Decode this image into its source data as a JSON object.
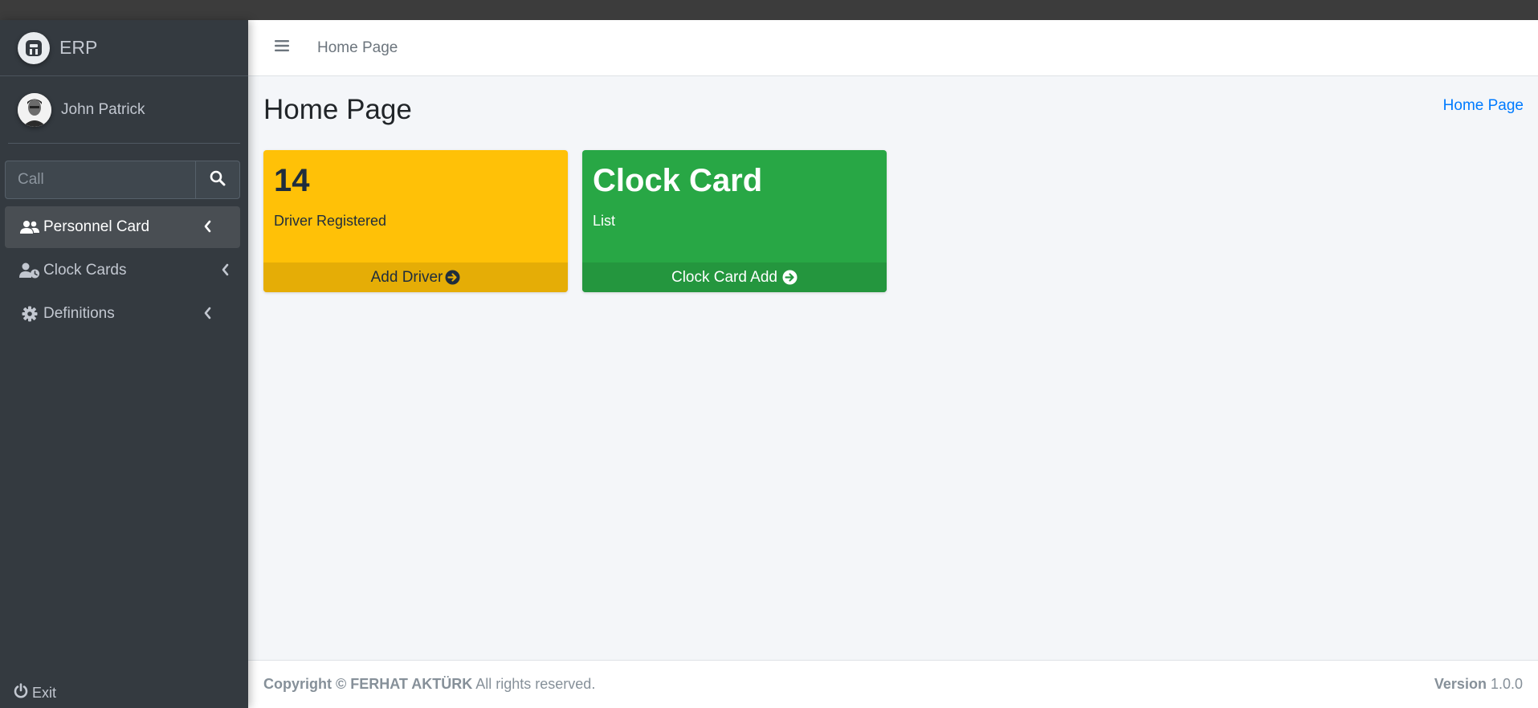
{
  "brand": {
    "name": "ERP"
  },
  "user": {
    "name": "John Patrick"
  },
  "search": {
    "placeholder": "Call"
  },
  "sidebar": {
    "items": [
      {
        "label": "Personnel Card",
        "icon": "users-icon",
        "active": true
      },
      {
        "label": "Clock Cards",
        "icon": "user-clock-icon",
        "active": false
      },
      {
        "label": "Definitions",
        "icon": "cog-icon",
        "active": false
      }
    ],
    "exit_label": "Exit"
  },
  "header": {
    "home_link": "Home Page"
  },
  "main": {
    "title": "Home Page",
    "breadcrumb": "Home Page",
    "cards": [
      {
        "value": "14",
        "label": "Driver Registered",
        "footer": "Add Driver",
        "color": "#ffc107"
      },
      {
        "value": "Clock Card",
        "label": "List",
        "footer": "Clock Card Add",
        "color": "#28a745"
      }
    ]
  },
  "footer": {
    "copyright": "Copyright © FERHAT AKTÜRK",
    "rights": "All rights reserved.",
    "version_label": "Version",
    "version": "1.0.0"
  },
  "colors": {
    "sidebar_bg": "#343a40",
    "link": "#007bff",
    "warning": "#ffc107",
    "success": "#28a745"
  }
}
